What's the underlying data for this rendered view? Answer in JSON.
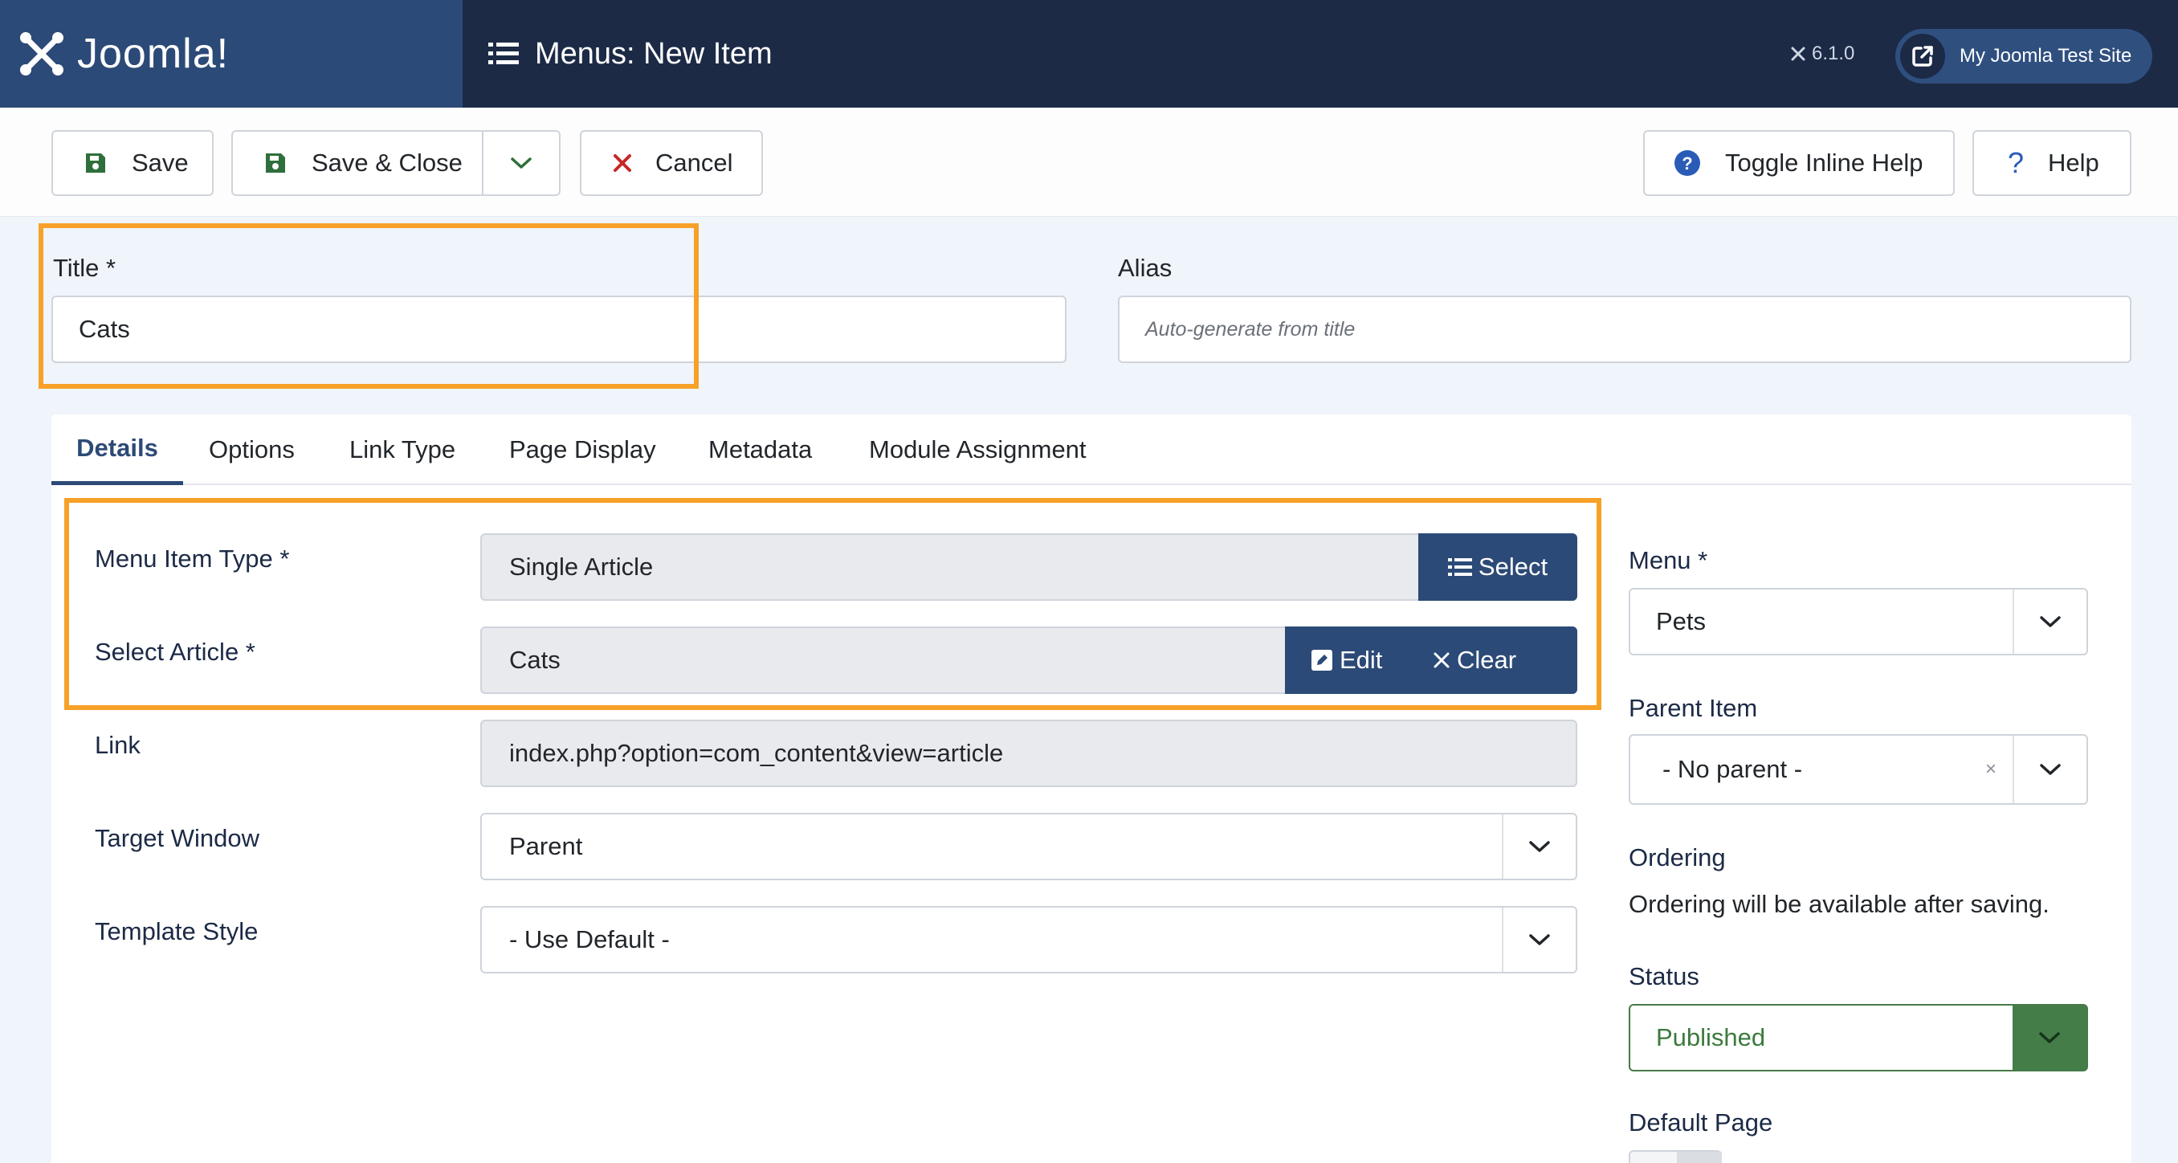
{
  "header": {
    "logo_text": "Joomla!",
    "page_title": "Menus: New Item",
    "version": "6.1.0",
    "site_button_label": "My Joomla Test Site"
  },
  "toolbar": {
    "save_label": "Save",
    "save_close_label": "Save & Close",
    "cancel_label": "Cancel",
    "toggle_help_label": "Toggle Inline Help",
    "help_label": "Help"
  },
  "form": {
    "title_label": "Title *",
    "title_value": "Cats",
    "alias_label": "Alias",
    "alias_placeholder": "Auto-generate from title"
  },
  "tabs": [
    "Details",
    "Options",
    "Link Type",
    "Page Display",
    "Metadata",
    "Module Assignment"
  ],
  "details": {
    "menu_item_type_label": "Menu Item Type *",
    "menu_item_type_value": "Single Article",
    "select_button": "Select",
    "select_article_label": "Select Article *",
    "select_article_value": "Cats",
    "edit_button": "Edit",
    "clear_button": "Clear",
    "link_label": "Link",
    "link_value": "index.php?option=com_content&view=article",
    "target_window_label": "Target Window",
    "target_window_value": "Parent",
    "template_style_label": "Template Style",
    "template_style_value": "- Use Default -"
  },
  "sidebar": {
    "menu_label": "Menu *",
    "menu_value": "Pets",
    "parent_label": "Parent Item",
    "parent_value": "- No parent -",
    "ordering_label": "Ordering",
    "ordering_text": "Ordering will be available after saving.",
    "status_label": "Status",
    "status_value": "Published",
    "default_page_label": "Default Page"
  },
  "colors": {
    "header_bg": "#1c2a46",
    "logo_bg": "#2c4a77",
    "accent_blue": "#2c4a77",
    "status_green": "#457d49",
    "highlight_orange": "#f7a128",
    "cancel_red": "#c52827"
  }
}
